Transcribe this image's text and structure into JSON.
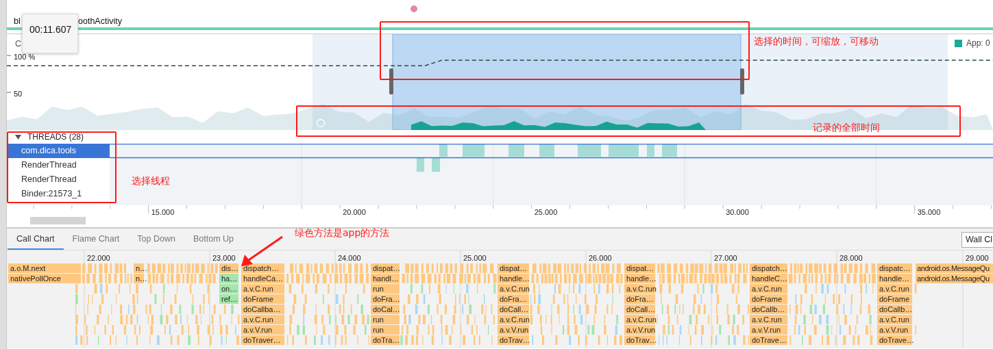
{
  "session": {
    "title_parts": [
      "bl",
      "oothActivity"
    ]
  },
  "tooltip": {
    "time": "00:11.607"
  },
  "cpu": {
    "label": "C",
    "axis_labels": [
      "100 %",
      "50"
    ],
    "legend": "App: 0"
  },
  "threads": {
    "header": "THREADS (28)",
    "expanded": true,
    "items": [
      {
        "name": "com.dica.tools",
        "selected": true
      },
      {
        "name": "RenderThread",
        "selected": false
      },
      {
        "name": "RenderThread",
        "selected": false
      },
      {
        "name": "Binder:21573_1",
        "selected": false
      }
    ]
  },
  "timeline_axis": [
    "15.000",
    "20.000",
    "25.000",
    "30.000",
    "35.000"
  ],
  "tabs": [
    {
      "label": "Call Chart",
      "selected": true
    },
    {
      "label": "Flame Chart",
      "selected": false
    },
    {
      "label": "Top Down",
      "selected": false
    },
    {
      "label": "Bottom Up",
      "selected": false
    }
  ],
  "clock_dropdown": {
    "value": "Wall Cl"
  },
  "call_chart": {
    "ruler": [
      "22.000",
      "23.000",
      "24.000",
      "25.000",
      "26.000",
      "27.000",
      "28.000",
      "29.000"
    ],
    "stacks": [
      {
        "frames": [
          {
            "label": "a.o.M.next",
            "kind": "system"
          },
          {
            "label": "nativePollOnce",
            "kind": "system"
          }
        ]
      },
      {
        "frames": [
          {
            "label": "n…",
            "kind": "system"
          },
          {
            "label": "n…",
            "kind": "system"
          }
        ]
      },
      {
        "frames": [
          {
            "label": "dis…",
            "kind": "system"
          },
          {
            "label": "ha…",
            "kind": "app"
          },
          {
            "label": "on…",
            "kind": "app"
          },
          {
            "label": "ref…",
            "kind": "app"
          }
        ]
      },
      {
        "frames": [
          {
            "label": "dispatch…",
            "kind": "system"
          },
          {
            "label": "handleCa…",
            "kind": "system"
          },
          {
            "label": "a.v.C.run",
            "kind": "system"
          },
          {
            "label": "doFrame",
            "kind": "system"
          },
          {
            "label": "doCallba…",
            "kind": "system"
          },
          {
            "label": "a.v.C.run",
            "kind": "system"
          },
          {
            "label": "a.v.V.run",
            "kind": "system"
          },
          {
            "label": "doTraver…",
            "kind": "system"
          }
        ]
      },
      {
        "frames": [
          {
            "label": "dispat…",
            "kind": "system"
          },
          {
            "label": "handl…",
            "kind": "system"
          },
          {
            "label": "run",
            "kind": "system"
          },
          {
            "label": "doFra…",
            "kind": "system"
          },
          {
            "label": "doCal…",
            "kind": "system"
          },
          {
            "label": "run",
            "kind": "system"
          },
          {
            "label": "run",
            "kind": "system"
          },
          {
            "label": "doTra…",
            "kind": "system"
          }
        ]
      },
      {
        "frames": [
          {
            "label": "dispat…",
            "kind": "system"
          },
          {
            "label": "handle…",
            "kind": "system"
          },
          {
            "label": "a.v.C.run",
            "kind": "system"
          },
          {
            "label": "doFra…",
            "kind": "system"
          },
          {
            "label": "doCall…",
            "kind": "system"
          },
          {
            "label": "a.v.C.run",
            "kind": "system"
          },
          {
            "label": "a.v.V.run",
            "kind": "system"
          },
          {
            "label": "doTrav…",
            "kind": "system"
          }
        ]
      },
      {
        "frames": [
          {
            "label": "dispat…",
            "kind": "system"
          },
          {
            "label": "handle…",
            "kind": "system"
          },
          {
            "label": "a.v.C.run",
            "kind": "system"
          },
          {
            "label": "doFra…",
            "kind": "system"
          },
          {
            "label": "doCall…",
            "kind": "system"
          },
          {
            "label": "a.v.C.run",
            "kind": "system"
          },
          {
            "label": "a.v.V.run",
            "kind": "system"
          },
          {
            "label": "doTrav…",
            "kind": "system"
          }
        ]
      },
      {
        "frames": [
          {
            "label": "dispatch…",
            "kind": "system"
          },
          {
            "label": "handleC…",
            "kind": "system"
          },
          {
            "label": "a.v.C.run",
            "kind": "system"
          },
          {
            "label": "doFrame",
            "kind": "system"
          },
          {
            "label": "doCallb…",
            "kind": "system"
          },
          {
            "label": "a.v.C.run",
            "kind": "system"
          },
          {
            "label": "a.v.V.run",
            "kind": "system"
          },
          {
            "label": "doTrave…",
            "kind": "system"
          }
        ]
      },
      {
        "frames": [
          {
            "label": "dispatc…",
            "kind": "system"
          },
          {
            "label": "handle…",
            "kind": "system"
          },
          {
            "label": "a.v.C.run",
            "kind": "system"
          },
          {
            "label": "doFrame",
            "kind": "system"
          },
          {
            "label": "doCallb…",
            "kind": "system"
          },
          {
            "label": "a.v.C.run",
            "kind": "system"
          },
          {
            "label": "a.v.V.run",
            "kind": "system"
          },
          {
            "label": "doTrave…",
            "kind": "system"
          }
        ]
      },
      {
        "frames": [
          {
            "label": "android.os.MessageQu",
            "kind": "system"
          },
          {
            "label": "android.os.MessageQu",
            "kind": "system"
          }
        ]
      }
    ]
  },
  "annotations": [
    {
      "text": "选择的时间，可缩放，可移动"
    },
    {
      "text": "记录的全部时间"
    },
    {
      "text": "选择线程"
    },
    {
      "text": "绿色方法是app的方法"
    }
  ]
}
